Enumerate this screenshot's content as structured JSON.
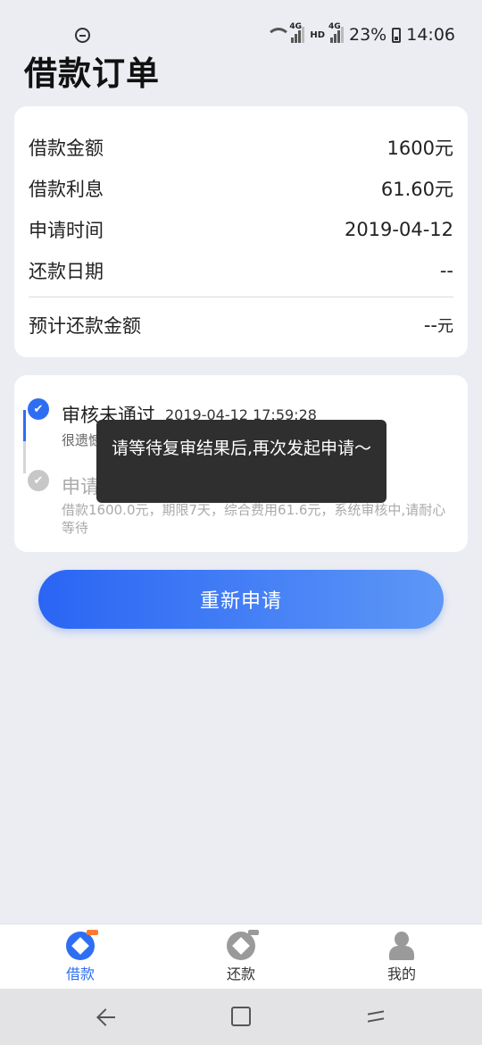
{
  "status_bar": {
    "net1": "4G",
    "hd": "HD",
    "net2": "4G",
    "battery": "23%",
    "time": "14:06"
  },
  "page": {
    "title": "借款订单"
  },
  "info": {
    "rows": [
      {
        "label": "借款金额",
        "value": "1600元"
      },
      {
        "label": "借款利息",
        "value": "61.60元"
      },
      {
        "label": "申请时间",
        "value": "2019-04-12"
      },
      {
        "label": "还款日期",
        "value": "--"
      }
    ],
    "total_label": "预计还款金额",
    "total_value": "--",
    "total_unit": "元"
  },
  "timeline": {
    "step1_title": "审核未通过",
    "step1_time": "2019-04-12 17:59:28",
    "step1_sub": "很遗憾",
    "step2_title": "申请",
    "step2_desc": "借款1600.0元，期限7天，综合费用61.6元，系统审核中,请耐心等待"
  },
  "toast": {
    "text": "请等待复审结果后,再次发起申请～"
  },
  "actions": {
    "reapply_label": "重新申请"
  },
  "tabs": [
    {
      "label": "借款",
      "icon": "borrow-icon",
      "active": true
    },
    {
      "label": "还款",
      "icon": "repay-icon",
      "active": false
    },
    {
      "label": "我的",
      "icon": "profile-icon",
      "active": false
    }
  ],
  "colors": {
    "accent": "#2e6ef2",
    "toast_bg": "#2f2f2f",
    "background": "#ebedf3"
  }
}
